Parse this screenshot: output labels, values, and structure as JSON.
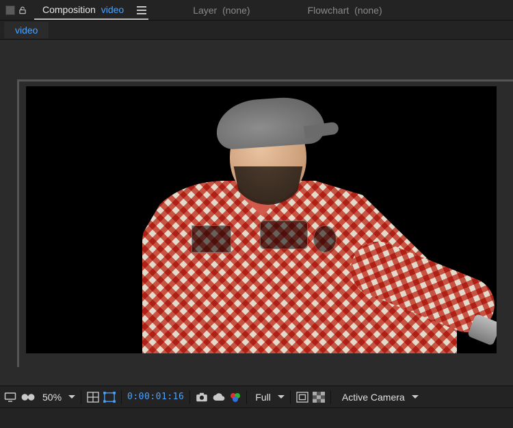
{
  "tabs": {
    "composition": {
      "label": "Composition",
      "comp_name": "video"
    },
    "layer": {
      "label": "Layer",
      "suffix": "(none)"
    },
    "flowchart": {
      "label": "Flowchart",
      "suffix": "(none)"
    }
  },
  "subtab": {
    "label": "video"
  },
  "controls": {
    "zoom": "50%",
    "timecode": "0:00:01:16",
    "resolution": "Full",
    "camera": "Active Camera"
  },
  "icons": {
    "monitor": "monitor-icon",
    "goggles": "goggles-icon",
    "zoom_caret": "chevron-down-icon",
    "grid": "grid-icon",
    "mask": "mask-bounds-icon",
    "camera": "camera-icon",
    "cloud": "cloud-icon",
    "swatches": "color-swatches-icon",
    "res_caret": "chevron-down-icon",
    "roi": "region-of-interest-icon",
    "transparency": "transparency-grid-icon",
    "cam_caret": "chevron-down-icon",
    "lock": "lock-open-icon",
    "menu": "panel-menu-icon"
  }
}
